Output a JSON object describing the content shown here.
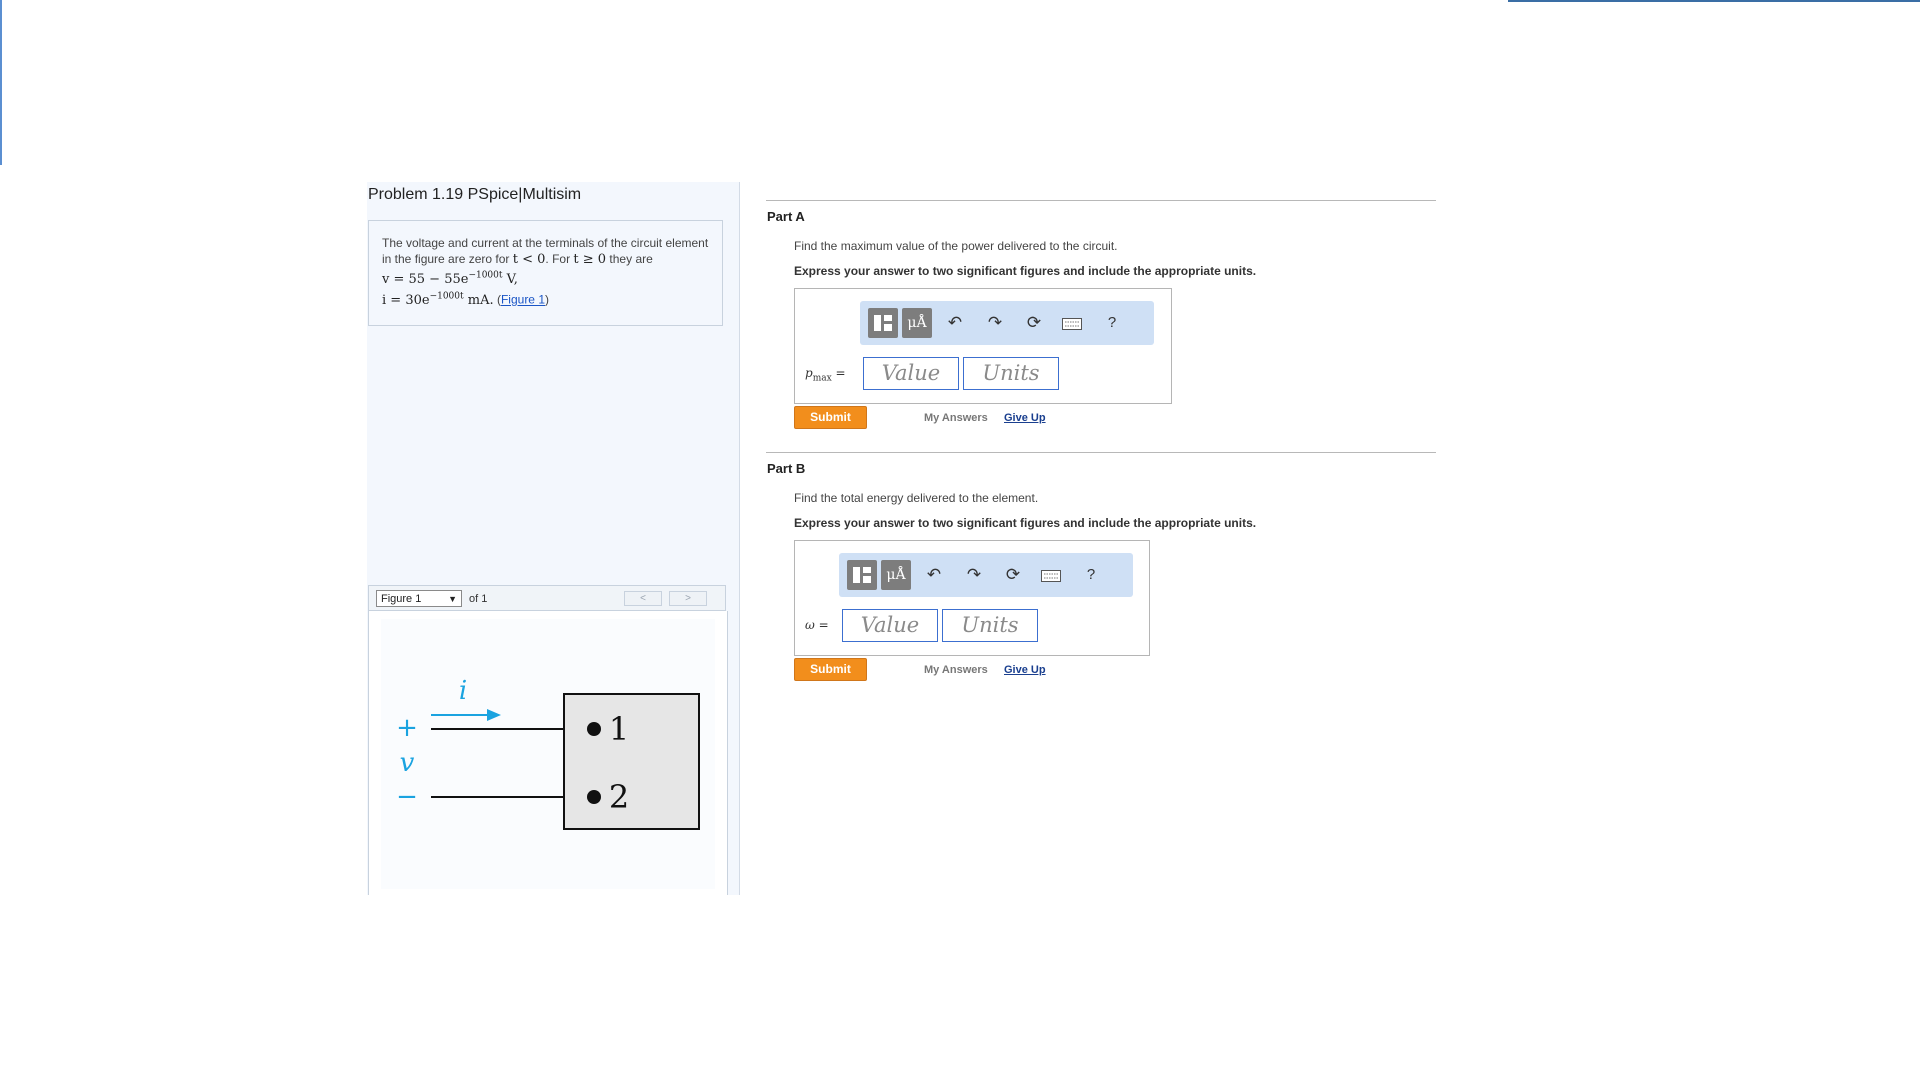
{
  "problem": {
    "title": "Problem 1.19 PSpice|Multisim",
    "text_1": "The voltage and current at the terminals of the circuit element in the figure are zero for",
    "math_t_lt": "t < 0",
    "text_2": ". For",
    "math_t_ge": "t ≥ 0",
    "text_3": "they are",
    "eq_v": "v = 55 − 55e",
    "eq_v_exp": "−1000t",
    "eq_v_unit": "V,",
    "eq_i": "i = 30e",
    "eq_i_exp": "−1000t",
    "eq_i_unit": "mA.",
    "figure_link": "Figure 1"
  },
  "figure": {
    "select_value": "Figure 1",
    "of_label": "of 1",
    "prev": "<",
    "next": ">",
    "current_label": "i",
    "plus": "+",
    "voltage_label": "v",
    "minus": "−",
    "terminal_1": "1",
    "terminal_2": "2",
    "colors": {
      "accent": "#1aa3e0"
    }
  },
  "parts": {
    "a": {
      "title": "Part A",
      "question": "Find the maximum value of the power delivered to the circuit.",
      "instruction": "Express your answer to two significant figures and include the appropriate units.",
      "var": "p",
      "var_sub": "max",
      "eq": "=",
      "value_placeholder": "Value",
      "units_placeholder": "Units",
      "submit": "Submit",
      "my_answers": "My Answers",
      "give_up": "Give Up"
    },
    "b": {
      "title": "Part B",
      "question": "Find the total energy delivered to the element.",
      "instruction": "Express your answer to two significant figures and include the appropriate units.",
      "var": "ω",
      "eq": "=",
      "value_placeholder": "Value",
      "units_placeholder": "Units",
      "submit": "Submit",
      "my_answers": "My Answers",
      "give_up": "Give Up"
    }
  },
  "toolbar": {
    "units_btn": "μÅ",
    "help": "?"
  },
  "icons": [
    "templates-icon",
    "units-icon",
    "undo-icon",
    "redo-icon",
    "reset-icon",
    "keyboard-icon",
    "help-icon"
  ],
  "colors": {
    "submit": "#f28e1c",
    "field_border": "#3c6fd0",
    "toolbar_bg": "#cfe0f5",
    "link": "#1a55c6"
  }
}
